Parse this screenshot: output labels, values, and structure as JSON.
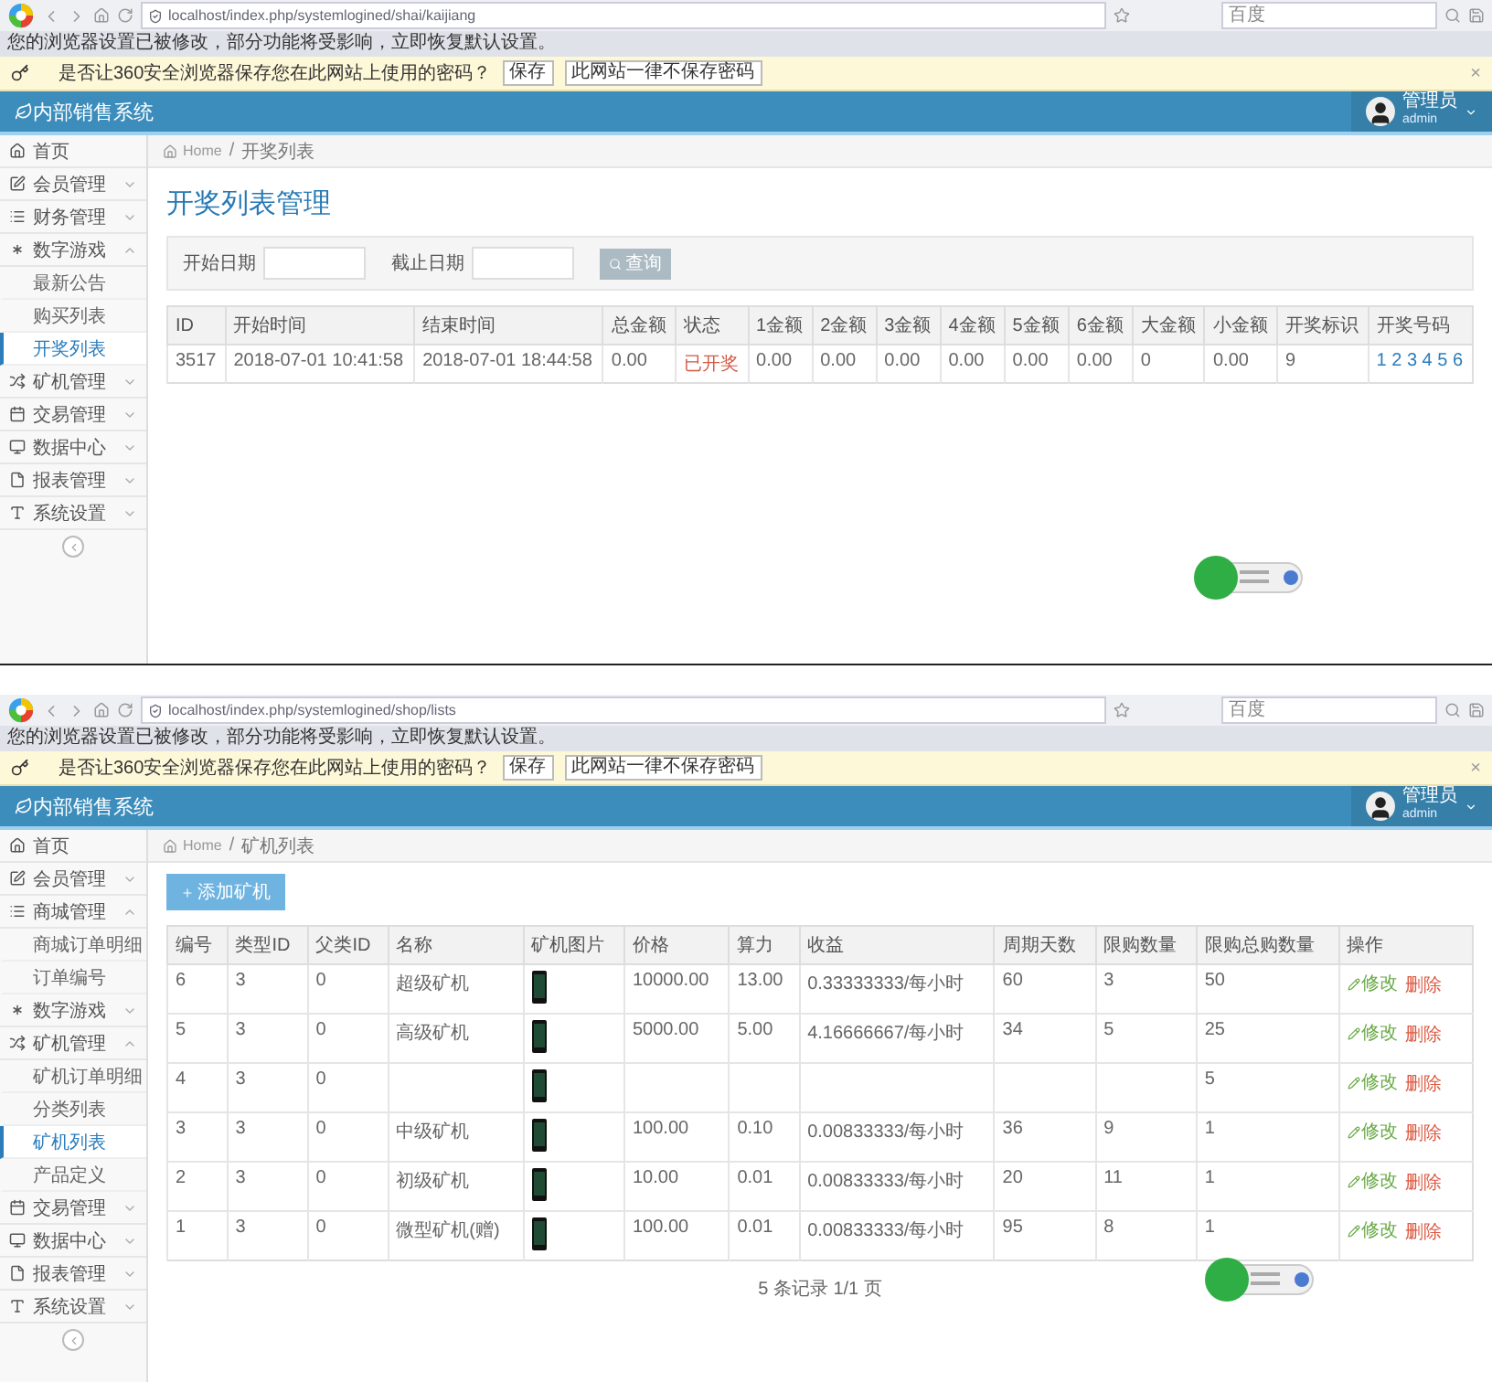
{
  "screens": [
    {
      "browser": {
        "url": "localhost/index.php/systemlogined/shai/kaijiang",
        "search": "百度",
        "info": "您的浏览器设置已被修改，部分功能将受影响，立即恢复默认设置。"
      },
      "notice": {
        "text": "是否让360安全浏览器保存您在此网站上使用的密码？",
        "buttons": [
          "保存",
          "此网站一律不保存密码"
        ],
        "close": "×"
      },
      "header": {
        "logo": "内部销售系统",
        "user_name": "管理员",
        "user_login": "admin"
      },
      "sidebar": [
        {
          "kind": "link",
          "label": "首页"
        },
        {
          "kind": "menu",
          "label": "会员管理",
          "expanded": false
        },
        {
          "kind": "menu",
          "label": "财务管理",
          "expanded": false
        },
        {
          "kind": "menu",
          "label": "数字游戏",
          "expanded": true,
          "children": [
            {
              "label": "最新公告",
              "selected": false
            },
            {
              "label": "购买列表",
              "selected": false
            },
            {
              "label": "开奖列表",
              "selected": true
            }
          ]
        },
        {
          "kind": "menu",
          "label": "矿机管理",
          "expanded": false
        },
        {
          "kind": "menu",
          "label": "交易管理",
          "expanded": false
        },
        {
          "kind": "menu",
          "label": "数据中心",
          "expanded": false
        },
        {
          "kind": "menu",
          "label": "报表管理",
          "expanded": false
        },
        {
          "kind": "menu",
          "label": "系统设置",
          "expanded": false
        }
      ],
      "breadcrumb": [
        "Home",
        "开奖列表"
      ],
      "breadcrumb_separator": "/",
      "content": {
        "kind": "lottery",
        "title": "开奖列表管理",
        "filters": [
          {
            "label": "开始日期"
          },
          {
            "label": "截止日期"
          }
        ],
        "search_button": "查询",
        "table": {
          "columns": [
            {
              "label": "ID",
              "kind": "text"
            },
            {
              "label": "开始时间",
              "kind": "text"
            },
            {
              "label": "结束时间",
              "kind": "text"
            },
            {
              "label": "总金额",
              "kind": "text"
            },
            {
              "label": "状态",
              "kind": "status"
            },
            {
              "label": "1金额",
              "kind": "text"
            },
            {
              "label": "2金额",
              "kind": "text"
            },
            {
              "label": "3金额",
              "kind": "text"
            },
            {
              "label": "4金额",
              "kind": "text"
            },
            {
              "label": "5金额",
              "kind": "text"
            },
            {
              "label": "6金额",
              "kind": "text"
            },
            {
              "label": "大金额",
              "kind": "text"
            },
            {
              "label": "小金额",
              "kind": "text"
            },
            {
              "label": "开奖标识",
              "kind": "text"
            },
            {
              "label": "开奖号码",
              "kind": "link"
            }
          ],
          "rows": [
            {
              "cells": [
                "3517",
                "2018-07-01 10:41:58",
                "2018-07-01 18:44:58",
                "0.00",
                "已开奖",
                "0.00",
                "0.00",
                "0.00",
                "0.00",
                "0.00",
                "0.00",
                "0",
                "0.00",
                "9",
                "1 2 3 4 5 6"
              ]
            }
          ]
        }
      }
    },
    {
      "browser": {
        "url": "localhost/index.php/systemlogined/shop/lists",
        "search": "百度",
        "info": "您的浏览器设置已被修改，部分功能将受影响，立即恢复默认设置。"
      },
      "notice": {
        "text": "是否让360安全浏览器保存您在此网站上使用的密码？",
        "buttons": [
          "保存",
          "此网站一律不保存密码"
        ],
        "close": "×"
      },
      "header": {
        "logo": "内部销售系统",
        "user_name": "管理员",
        "user_login": "admin"
      },
      "sidebar": [
        {
          "kind": "link",
          "label": "首页"
        },
        {
          "kind": "menu",
          "label": "会员管理",
          "expanded": false
        },
        {
          "kind": "menu",
          "label": "商城管理",
          "expanded": true,
          "children": [
            {
              "label": "商城订单明细",
              "selected": false
            },
            {
              "label": "订单编号",
              "selected": false
            }
          ]
        },
        {
          "kind": "menu",
          "label": "数字游戏",
          "expanded": false
        },
        {
          "kind": "menu",
          "label": "矿机管理",
          "expanded": true,
          "children": [
            {
              "label": "矿机订单明细",
              "selected": false
            },
            {
              "label": "分类列表",
              "selected": false
            },
            {
              "label": "矿机列表",
              "selected": true
            },
            {
              "label": "产品定义",
              "selected": false
            }
          ]
        },
        {
          "kind": "menu",
          "label": "交易管理",
          "expanded": false
        },
        {
          "kind": "menu",
          "label": "数据中心",
          "expanded": false
        },
        {
          "kind": "menu",
          "label": "报表管理",
          "expanded": false
        },
        {
          "kind": "menu",
          "label": "系统设置",
          "expanded": false
        }
      ],
      "breadcrumb": [
        "Home",
        "矿机列表"
      ],
      "breadcrumb_separator": "/",
      "content": {
        "kind": "miners",
        "add_button": "添加矿机",
        "table": {
          "columns": [
            {
              "label": "编号",
              "kind": "text"
            },
            {
              "label": "类型ID",
              "kind": "text"
            },
            {
              "label": "父类ID",
              "kind": "text"
            },
            {
              "label": "名称",
              "kind": "text"
            },
            {
              "label": "矿机图片",
              "kind": "image"
            },
            {
              "label": "价格",
              "kind": "text"
            },
            {
              "label": "算力",
              "kind": "text"
            },
            {
              "label": "收益",
              "kind": "text"
            },
            {
              "label": "周期天数",
              "kind": "text"
            },
            {
              "label": "限购数量",
              "kind": "text"
            },
            {
              "label": "限购总购数量",
              "kind": "text"
            },
            {
              "label": "操作",
              "kind": "actions"
            }
          ],
          "rows": [
            {
              "image": true,
              "cells": [
                "6",
                "3",
                "0",
                "超级矿机",
                "",
                "10000.00",
                "13.00",
                "0.33333333/每小时",
                "60",
                "3",
                "50"
              ],
              "actions": [
                "修改",
                "删除"
              ]
            },
            {
              "image": true,
              "cells": [
                "5",
                "3",
                "0",
                "高级矿机",
                "",
                "5000.00",
                "5.00",
                "4.16666667/每小时",
                "34",
                "5",
                "25"
              ],
              "actions": [
                "修改",
                "删除"
              ]
            },
            {
              "image": true,
              "cells": [
                "4",
                "3",
                "0",
                null,
                "",
                null,
                null,
                null,
                null,
                null,
                "5"
              ],
              "actions": [
                "修改",
                "删除"
              ]
            },
            {
              "image": true,
              "cells": [
                "3",
                "3",
                "0",
                "中级矿机",
                "",
                "100.00",
                "0.10",
                "0.00833333/每小时",
                "36",
                "9",
                "1"
              ],
              "actions": [
                "修改",
                "删除"
              ]
            },
            {
              "image": true,
              "cells": [
                "2",
                "3",
                "0",
                "初级矿机",
                "",
                "10.00",
                "0.01",
                "0.00833333/每小时",
                "20",
                "11",
                "1"
              ],
              "actions": [
                "修改",
                "删除"
              ]
            },
            {
              "image": true,
              "cells": [
                "1",
                "3",
                "0",
                "微型矿机(赠)",
                "",
                "100.00",
                "0.01",
                "0.00833333/每小时",
                "95",
                "8",
                "1"
              ],
              "actions": [
                "修改",
                "删除"
              ]
            }
          ]
        },
        "footer": "5 条记录 1/1 页"
      }
    }
  ]
}
